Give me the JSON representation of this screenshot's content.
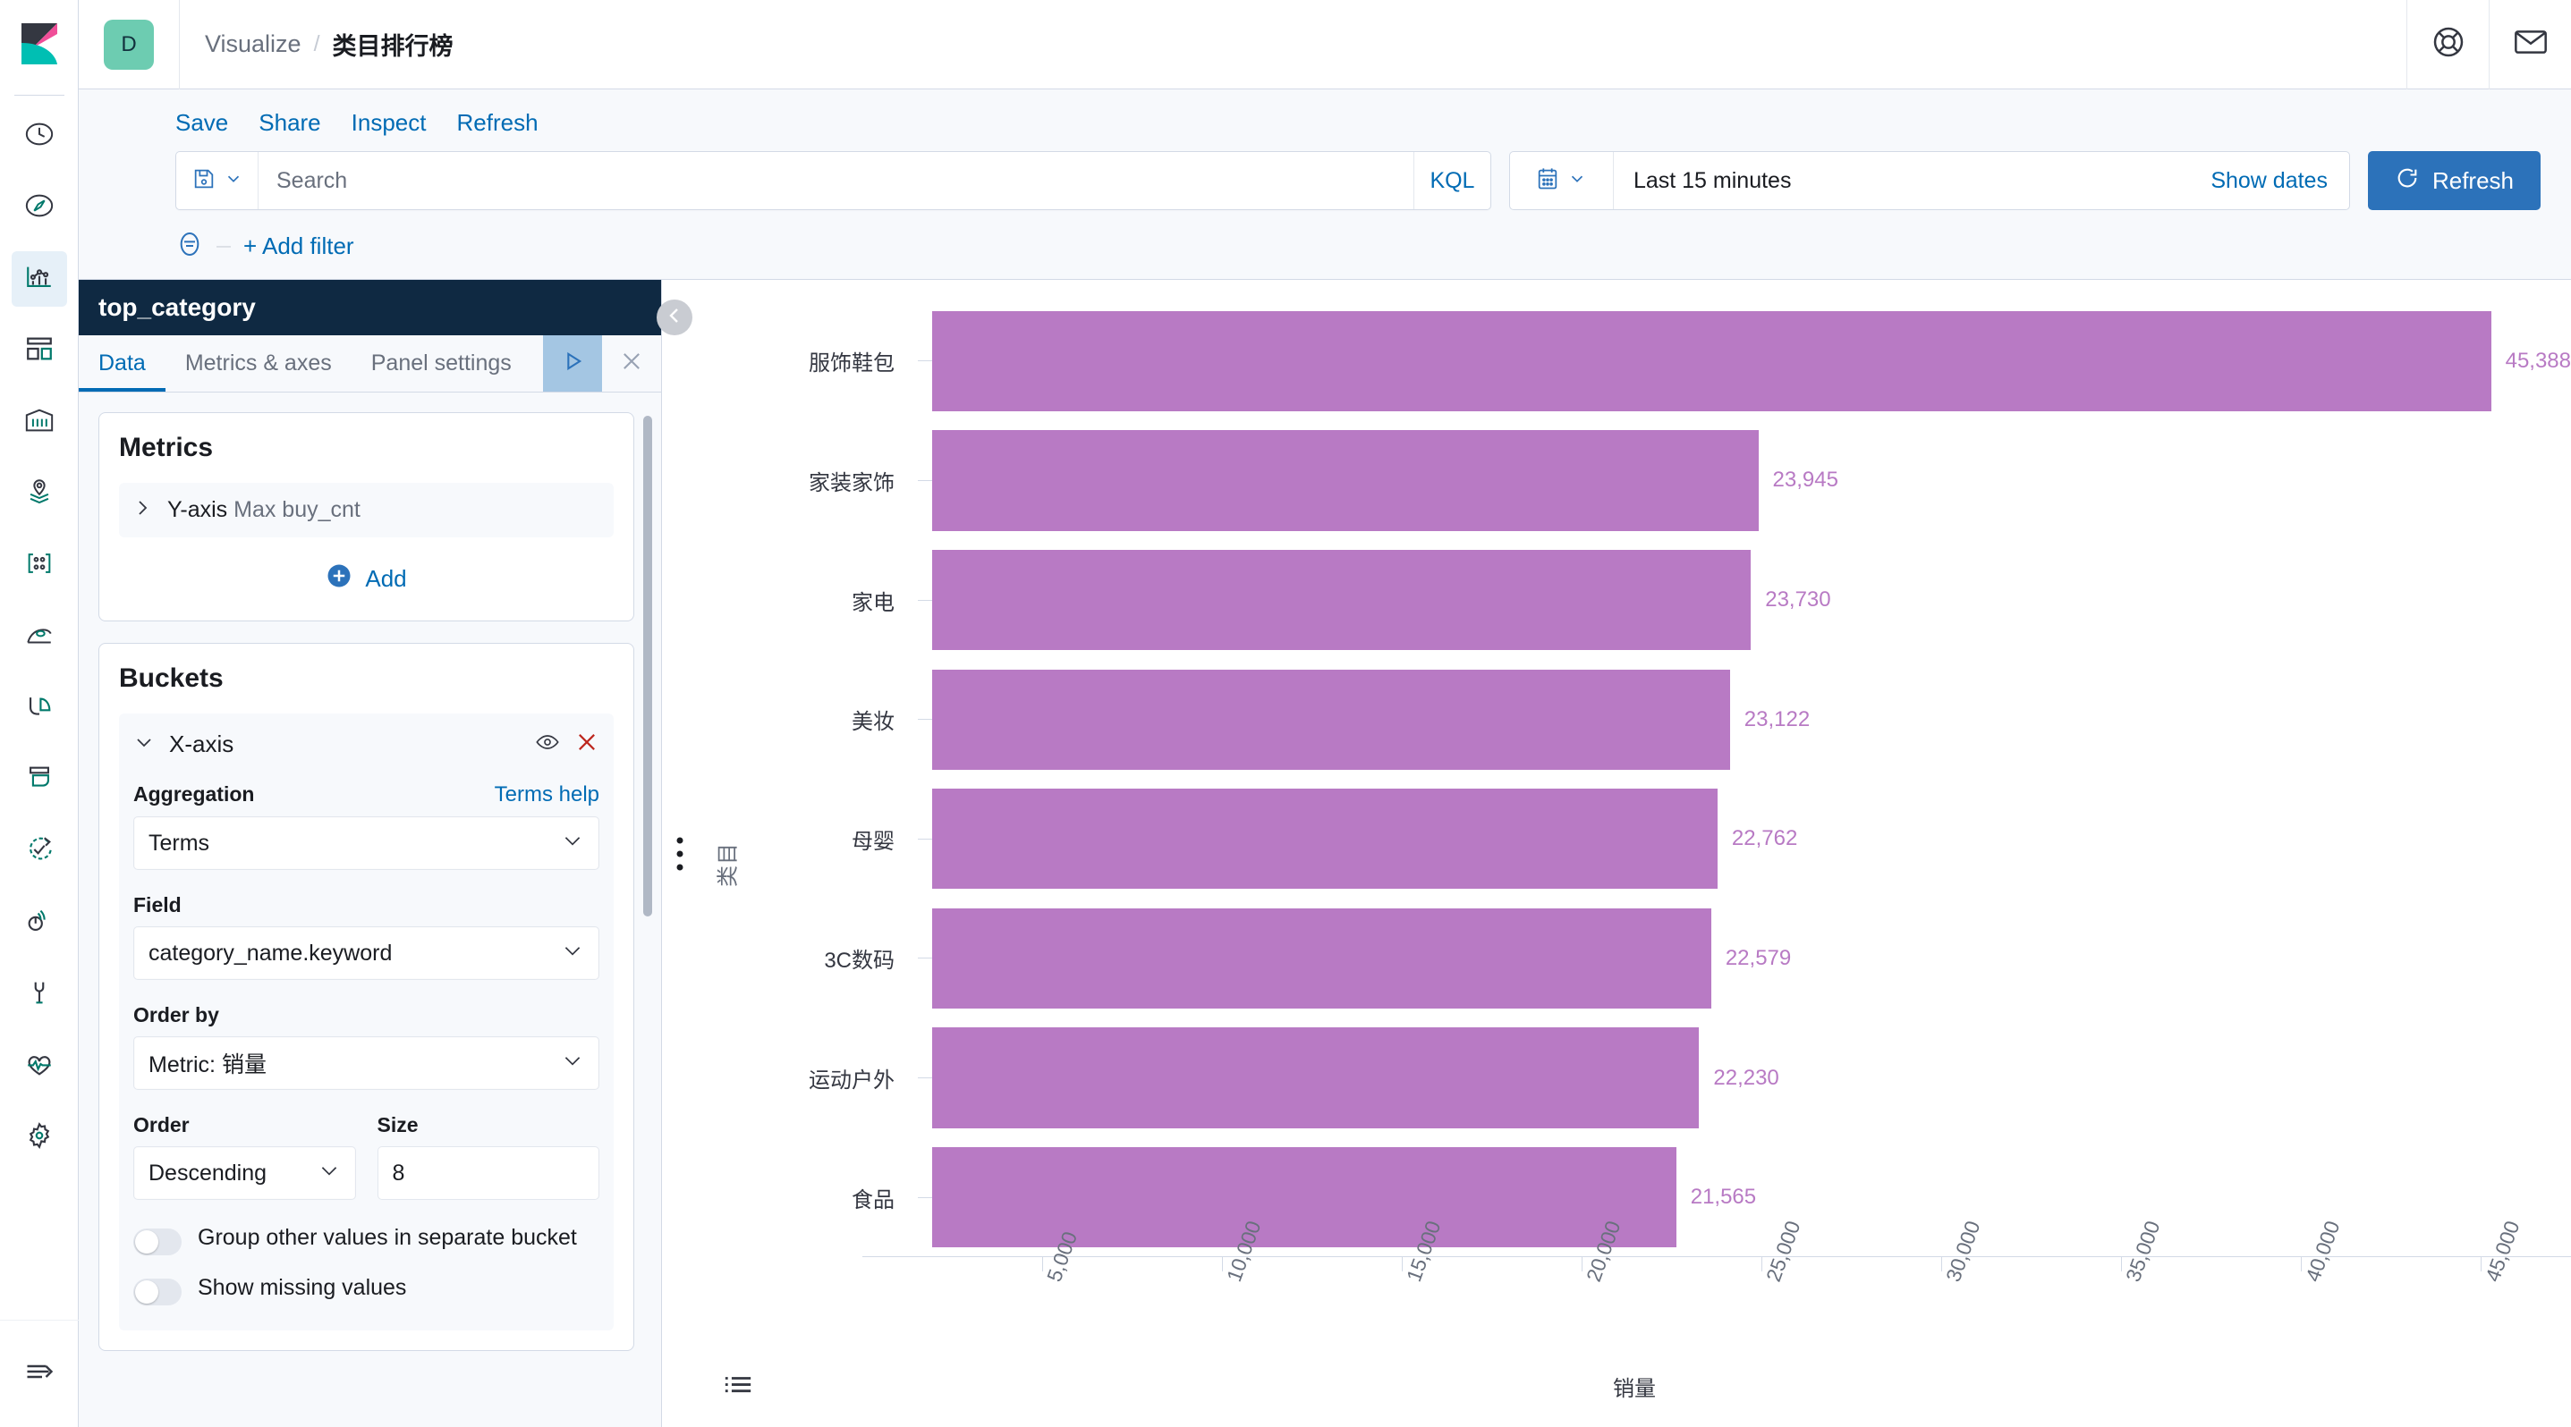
{
  "header": {
    "space_avatar": "D",
    "breadcrumb_parent": "Visualize",
    "breadcrumb_separator": "/",
    "breadcrumb_current": "类目排行榜",
    "help_icon": "help-lifebuoy-icon",
    "mail_icon": "mail-envelope-icon",
    "logo_icon": "kibana-logo-icon"
  },
  "nav": {
    "items": [
      {
        "name": "recently-viewed",
        "icon": "clock-icon"
      },
      {
        "name": "discover",
        "icon": "compass-icon"
      },
      {
        "name": "visualize",
        "icon": "bar-chart-icon",
        "active": true
      },
      {
        "name": "dashboard",
        "icon": "dashboard-grid-icon"
      },
      {
        "name": "canvas",
        "icon": "canvas-icon"
      },
      {
        "name": "maps",
        "icon": "map-pin-layers-icon"
      },
      {
        "name": "graph",
        "icon": "graph-nodes-icon"
      },
      {
        "name": "machine-learning",
        "icon": "machine-learning-icon"
      },
      {
        "name": "infrastructure",
        "icon": "infrastructure-icon"
      },
      {
        "name": "logs",
        "icon": "logs-icon"
      },
      {
        "name": "uptime",
        "icon": "uptime-check-icon"
      },
      {
        "name": "apm",
        "icon": "apm-signal-icon"
      },
      {
        "name": "dev-tools",
        "icon": "wrench-icon"
      },
      {
        "name": "monitoring",
        "icon": "heartbeat-icon"
      },
      {
        "name": "management",
        "icon": "gear-icon"
      }
    ],
    "collapse_icon": "collapse-arrow-icon"
  },
  "toolbar": {
    "links": [
      "Save",
      "Share",
      "Inspect",
      "Refresh"
    ],
    "saved_query_icon": "save-disk-icon",
    "search_placeholder": "Search",
    "search_value": "",
    "kql_label": "KQL",
    "calendar_icon": "calendar-icon",
    "date_range": "Last 15 minutes",
    "show_dates": "Show dates",
    "refresh_button": "Refresh",
    "refresh_icon": "refresh-circle-icon",
    "filter_icon": "filter-icon",
    "add_filter": "+ Add filter",
    "filter_dash": "—"
  },
  "editor": {
    "title": "top_category",
    "tabs": [
      {
        "label": "Data",
        "active": true
      },
      {
        "label": "Metrics & axes",
        "active": false
      },
      {
        "label": "Panel settings",
        "active": false
      }
    ],
    "apply_icon": "play-apply-icon",
    "close_icon": "close-x-icon",
    "collapse_icon": "chevron-left-icon",
    "metrics": {
      "title": "Metrics",
      "row_expand_icon": "chevron-right-icon",
      "row_label": "Y-axis",
      "row_value": "Max buy_cnt",
      "add_icon": "plus-circle-icon",
      "add_label": "Add"
    },
    "buckets": {
      "title": "Buckets",
      "x_axis": {
        "expand_icon": "chevron-down-icon",
        "name": "X-axis",
        "eye_icon": "eye-icon",
        "remove_icon": "remove-x-icon",
        "aggregation_label": "Aggregation",
        "terms_help": "Terms help",
        "aggregation_value": "Terms",
        "field_label": "Field",
        "field_value": "category_name.keyword",
        "order_by_label": "Order by",
        "order_by_value": "Metric: 销量",
        "order_label": "Order",
        "order_value": "Descending",
        "size_label": "Size",
        "size_value": "8",
        "toggle_group_other": "Group other values in separate bucket",
        "toggle_show_missing": "Show missing values"
      }
    }
  },
  "chart_data": {
    "type": "bar",
    "orientation": "horizontal",
    "title": "",
    "xlabel": "销量",
    "ylabel": "类目",
    "xlim": [
      0,
      47500
    ],
    "xticks": [
      5000,
      10000,
      15000,
      20000,
      25000,
      30000,
      35000,
      40000,
      45000
    ],
    "xtick_labels": [
      "5,000",
      "10,000",
      "15,000",
      "20,000",
      "25,000",
      "30,000",
      "35,000",
      "40,000",
      "45,000"
    ],
    "bar_color": "#b87ac4",
    "label_color": "#b87ac4",
    "grid": false,
    "legend": "none",
    "categories": [
      "服饰鞋包",
      "家装家饰",
      "家电",
      "美妆",
      "母婴",
      "3C数码",
      "运动户外",
      "食品"
    ],
    "values": [
      45388,
      23945,
      23730,
      23122,
      22762,
      22579,
      22230,
      21565
    ],
    "value_labels": [
      "45,388",
      "23,945",
      "23,730",
      "23,122",
      "22,762",
      "22,579",
      "22,230",
      "21,565"
    ]
  },
  "chart_ui": {
    "legend_toggle_icon": "legend-list-icon",
    "splitter_icon": "drag-grip-icon"
  }
}
